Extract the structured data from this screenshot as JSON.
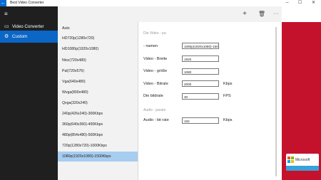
{
  "window": {
    "title": "Best Video Converter",
    "back_glyph": "←",
    "controls": {
      "minimize": "─",
      "maximize": "☐",
      "close": "✕"
    }
  },
  "sidebar": {
    "menu_glyph": "≡",
    "items": [
      {
        "label": "Video Converter",
        "icon": "film-icon",
        "glyph": "▭"
      },
      {
        "label": "Custom",
        "icon": "gear-icon",
        "glyph": "⚙"
      }
    ]
  },
  "cmdbar": {
    "add_glyph": "+",
    "delete_glyph": "🗑",
    "more_glyph": "···"
  },
  "presets": {
    "items": [
      "Auto",
      "HD720p(1280x720)",
      "HD1080p(1920x1080)",
      "Ntsc(720x480)",
      "Pal(720x576)",
      "Vga(640x480)",
      "Wvga(800x480)",
      "Qvga(320x240)",
      "240p(426x240)-300Kbpx",
      "360p(640x360)-400Kbpx",
      "480p(854x480)-500Kbpx",
      "720p(1280x720)-1000Kbpx",
      "1080p(1920x1080)-1500Kbpx"
    ],
    "selected": "1080p(1920x1080)-1500Kbpx"
  },
  "settings": {
    "video_section": "Die Video - pa",
    "audio_section": "Audio - param",
    "name_label": "- namen",
    "name_value": "1080p(1920x1080)-150",
    "width_label": "Video - Breite",
    "width_value": "1920",
    "height_label": "Video - größe",
    "height_value": "1080",
    "bitrate_label": "Video - Bitrate",
    "bitrate_value": "2000",
    "bitrate_unit": "Kbps",
    "framerate_label": "Die bildrate",
    "framerate_value": "30",
    "framerate_unit": "FPS",
    "audio_bitrate_label": "Audio - bit rate",
    "audio_bitrate_value": "192",
    "audio_bitrate_unit": "Kbps"
  },
  "promo": {
    "brand": "Microsoft",
    "colors": [
      "#f25022",
      "#7fba00",
      "#00a4ef",
      "#ffb900"
    ]
  }
}
